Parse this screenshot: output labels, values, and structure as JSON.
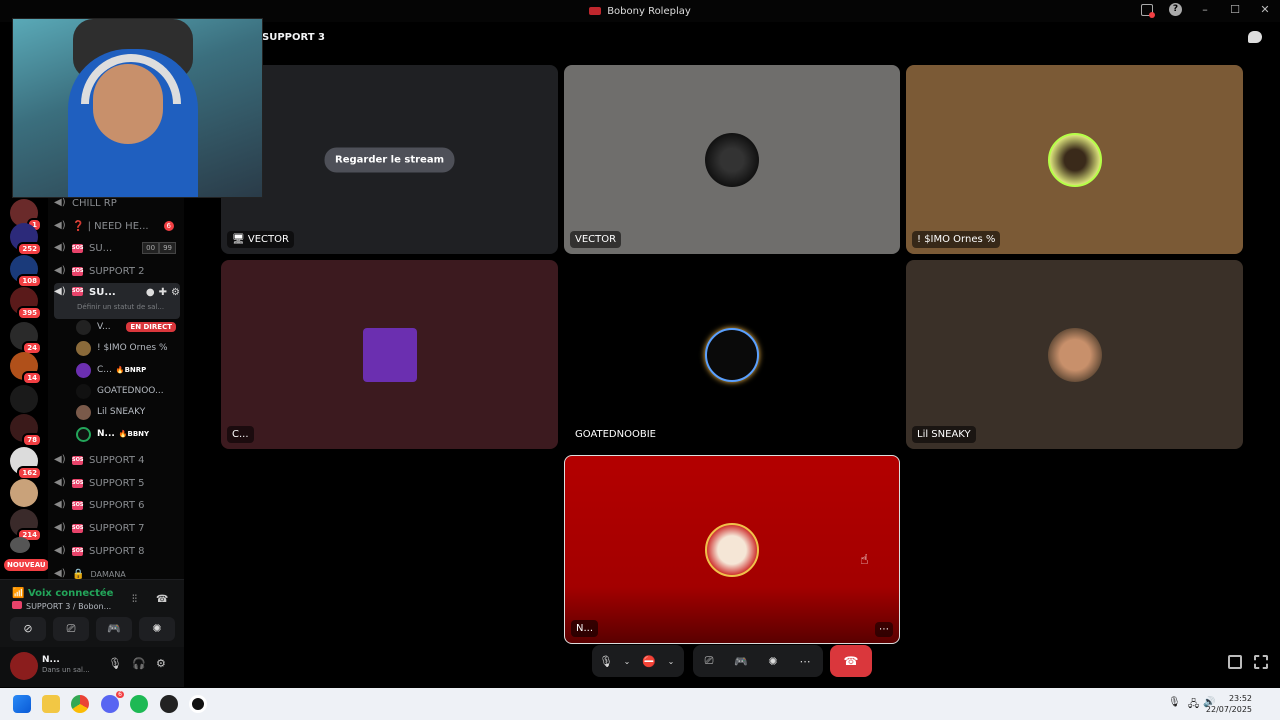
{
  "window": {
    "title": "Bobony Roleplay"
  },
  "call": {
    "title": "SUPPORT 3"
  },
  "servers": [
    {
      "badge": "1"
    },
    {
      "badge": "252"
    },
    {
      "badge": "108"
    },
    {
      "badge": "395"
    },
    {
      "badge": "24"
    },
    {
      "badge": "14"
    },
    {
      "badge": "78"
    },
    {
      "badge": "162"
    },
    {
      "badge": "214"
    }
  ],
  "servers_new_label": "NOUVEAU",
  "channels": {
    "chill": "CHILL RP",
    "need_help": {
      "label": "❓ | NEED HE...",
      "badge": "6"
    },
    "su1": {
      "label": "SU...",
      "b1": "00",
      "b2": "99"
    },
    "support2": "SUPPORT 2",
    "support3": {
      "label": "SU...",
      "sub": "Définir un statut de sal..."
    },
    "support4": "SUPPORT 4",
    "support5": "SUPPORT 5",
    "support6": "SUPPORT 6",
    "support7": "SUPPORT 7",
    "support8": "SUPPORT 8",
    "damana": "DAMANA"
  },
  "voice_users": [
    {
      "name": "V...",
      "live": "EN DIRECT"
    },
    {
      "name": "! $IMO Ornes %",
      "tag": ""
    },
    {
      "name": "C...",
      "tag": "BNRP"
    },
    {
      "name": "GOATEDNOO...",
      "tag": ""
    },
    {
      "name": "Lil SNEAKY",
      "tag": ""
    },
    {
      "name": "N...",
      "tag": "BBNY"
    }
  ],
  "voice_panel": {
    "title": "Voix connectée",
    "channel": "SUPPORT 3 / Bobon..."
  },
  "user": {
    "name": "N...",
    "status": "Dans un sal..."
  },
  "tiles": [
    {
      "name": "VECTOR",
      "button": "Regarder le stream"
    },
    {
      "name": "VECTOR"
    },
    {
      "name": "! $IMO Ornes %"
    },
    {
      "name": "C..."
    },
    {
      "name": "GOATEDNOOBIE"
    },
    {
      "name": "Lil SNEAKY"
    },
    {
      "name": "N..."
    }
  ],
  "taskbar": {
    "time": "23:52",
    "date": "22/07/2025",
    "discord_badge": "6"
  },
  "colors": {
    "accent_red": "#da373c",
    "online_green": "#23a55a",
    "tile_red": "#b00000"
  },
  "icons": [
    "mic-icon",
    "camera-off-icon",
    "screen-share-icon",
    "activities-icon",
    "soundboard-icon",
    "more-icon",
    "hangup-icon",
    "chat-icon",
    "popout-icon",
    "fullscreen-icon"
  ]
}
